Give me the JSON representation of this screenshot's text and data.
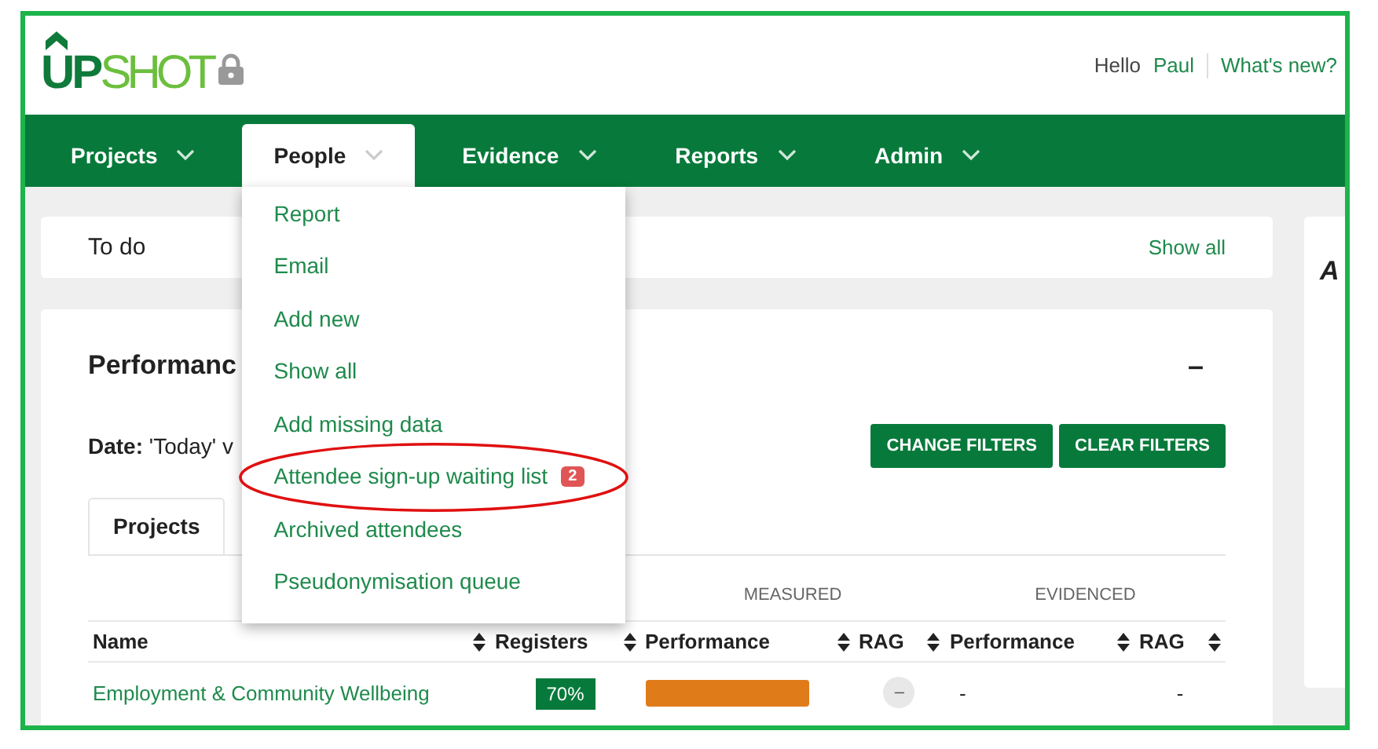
{
  "header": {
    "logo_primary": "UP",
    "logo_secondary": "SHOT",
    "greeting": "Hello",
    "user": "Paul",
    "whats_new": "What's new?"
  },
  "nav": [
    {
      "label": "Projects",
      "selected": false
    },
    {
      "label": "People",
      "selected": true
    },
    {
      "label": "Evidence",
      "selected": false
    },
    {
      "label": "Reports",
      "selected": false
    },
    {
      "label": "Admin",
      "selected": false
    }
  ],
  "people_menu": [
    {
      "label": "Report",
      "circled": false
    },
    {
      "label": "Email",
      "circled": false
    },
    {
      "label": "Add new",
      "circled": false
    },
    {
      "label": "Show all",
      "circled": false
    },
    {
      "label": "Add missing data",
      "circled": false
    },
    {
      "label": "Attendee sign-up waiting list",
      "badge": "2",
      "circled": true
    },
    {
      "label": "Archived attendees",
      "circled": false
    },
    {
      "label": "Pseudonymisation queue",
      "circled": false
    }
  ],
  "todo": {
    "title": "To do",
    "link": "Show all"
  },
  "performance": {
    "title": "Performanc",
    "collapse": "–",
    "date_label": "Date:",
    "date_value": "'Today' v",
    "buttons": [
      "CHANGE FILTERS",
      "CLEAR FILTERS"
    ],
    "tabs": [
      {
        "label": "Projects",
        "selected": true
      }
    ],
    "groups": [
      "MEASURED",
      "EVIDENCED"
    ],
    "columns": [
      "Name",
      "Registers",
      "Performance",
      "RAG",
      "Performance",
      "RAG"
    ],
    "rows": [
      {
        "name": "Employment & Community Wellbeing",
        "registers": "70%",
        "rag": "–",
        "evidenced_performance": "-",
        "evidenced_rag": "-"
      }
    ]
  },
  "side_card": {
    "title": "A"
  }
}
